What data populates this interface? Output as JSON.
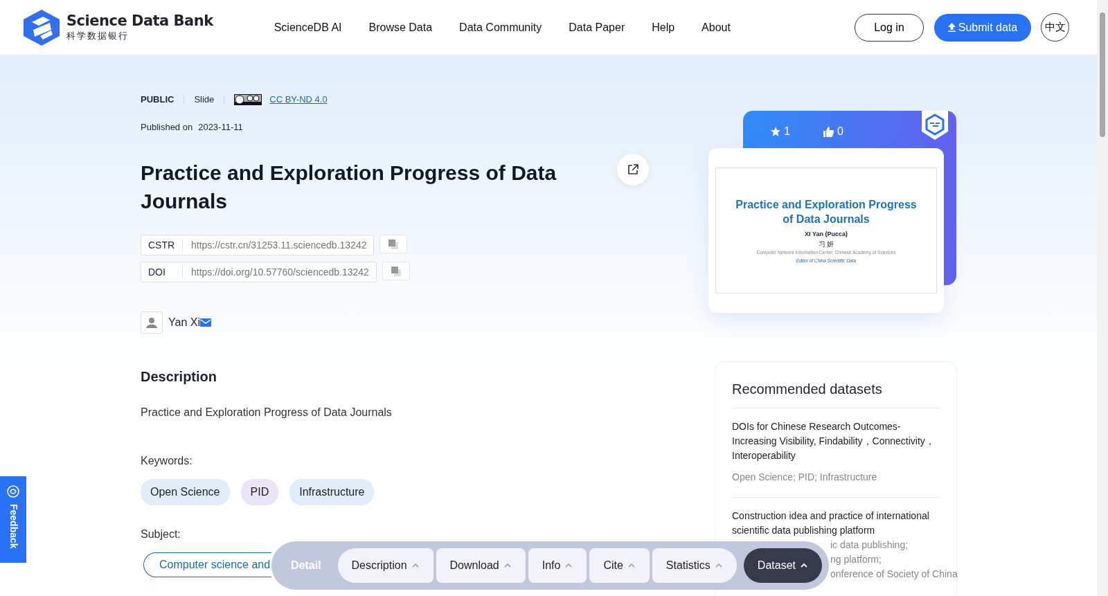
{
  "header": {
    "logo": {
      "title": "Science Data Bank",
      "subtitle": "科学数据银行"
    },
    "nav": [
      "ScienceDB AI",
      "Browse Data",
      "Data Community",
      "Data Paper",
      "Help",
      "About"
    ],
    "login": "Log in",
    "submit": "Submit data",
    "language": "中文"
  },
  "meta": {
    "access": "PUBLIC",
    "type": "Slide",
    "license": "CC BY-ND 4.0",
    "published_label": "Published on",
    "published_date": "2023-11-11"
  },
  "title": "Practice and Exploration Progress of Data Journals",
  "identifiers": [
    {
      "label": "CSTR",
      "value": "https://cstr.cn/31253.11.sciencedb.13242"
    },
    {
      "label": "DOI",
      "value": "https://doi.org/10.57760/sciencedb.13242"
    }
  ],
  "authors": [
    {
      "name": "Yan Xi",
      "has_email": true
    }
  ],
  "description": {
    "heading": "Description",
    "text": "Practice and Exploration Progress of Data Journals"
  },
  "keywords": {
    "label": "Keywords:",
    "items": [
      {
        "text": "Open Science",
        "color": "#e2ecf8"
      },
      {
        "text": "PID",
        "color": "#ece4f6"
      },
      {
        "text": "Infrastructure",
        "color": "#e2ecf8"
      }
    ]
  },
  "subject": {
    "label": "Subject:",
    "items": [
      "Computer science and"
    ]
  },
  "stats": {
    "favorites": "1",
    "likes": "0"
  },
  "preview": {
    "title": "Practice and Exploration Progress of Data Journals",
    "author": "XI Yan (Pucca)",
    "author_cn": "习 妍",
    "affiliation": "Computer Network Information Center, Chinese Academy of Sciences",
    "role": "Editor of China Scientific Data"
  },
  "recommended": {
    "heading": "Recommended datasets",
    "items": [
      {
        "title": "DOIs for Chinese Research Outcomes-Increasing Visibility, Findability，Connectivity，Interoperability",
        "keywords": [
          "Open Science; PID; Infrastructure"
        ]
      },
      {
        "title": "Construction idea and practice of international scientific data publishing platform",
        "keywords": [
          "ic data publishing;",
          "ng platform;",
          "onference of Society of China"
        ]
      }
    ]
  },
  "feedback": "Feedback",
  "section_nav": {
    "label": "Detail",
    "items": [
      {
        "label": "Description",
        "selected": false
      },
      {
        "label": "Download",
        "selected": false
      },
      {
        "label": "Info",
        "selected": false
      },
      {
        "label": "Cite",
        "selected": false
      },
      {
        "label": "Statistics",
        "selected": false
      },
      {
        "label": "Dataset",
        "selected": true
      }
    ]
  }
}
